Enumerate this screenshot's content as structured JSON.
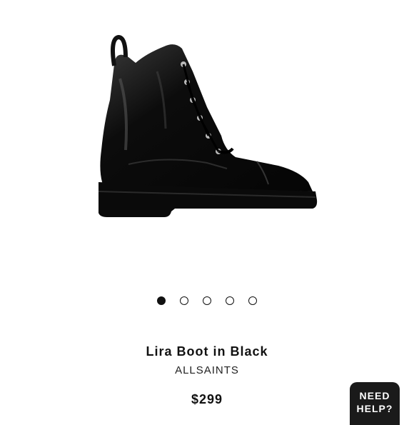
{
  "product": {
    "image_icon": "boot-product-image",
    "name": "Lira Boot in Black",
    "brand": "ALLSAINTS",
    "price": "$299"
  },
  "carousel": {
    "total": 5,
    "active_index": 0
  },
  "help": {
    "line1": "NEED",
    "line2": "HELP?"
  }
}
